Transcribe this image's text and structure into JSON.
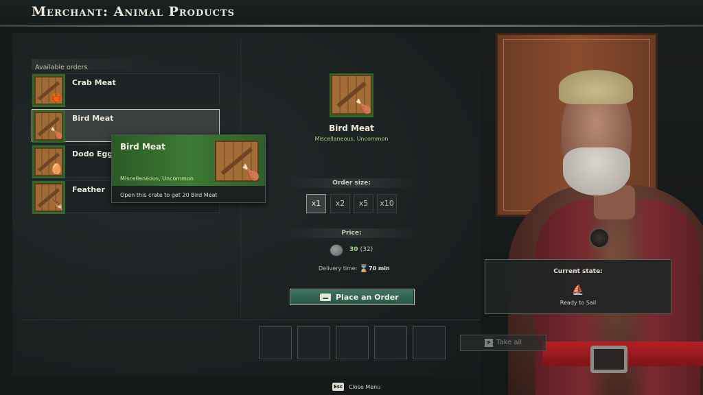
{
  "window": {
    "title": "Merchant: Animal Products"
  },
  "orders": {
    "header": "Available orders",
    "items": [
      {
        "label": "Crab Meat",
        "icon": "crab-meat-icon",
        "item_glyph": "🦀"
      },
      {
        "label": "Bird Meat",
        "icon": "bird-meat-icon",
        "item_glyph": "🍗",
        "selected": true
      },
      {
        "label": "Dodo Egg",
        "icon": "dodo-egg-icon",
        "item_glyph": "🥚"
      },
      {
        "label": "Feather",
        "icon": "feather-icon",
        "item_glyph": "🪶"
      }
    ]
  },
  "tooltip": {
    "name": "Bird Meat",
    "subtitle": "Miscellaneous, Uncommon",
    "description": "Open this crate to get 20 Bird Meat"
  },
  "detail": {
    "name": "Bird Meat",
    "subtitle": "Miscellaneous, Uncommon",
    "order_size_label": "Order size:",
    "order_sizes": [
      "x1",
      "x2",
      "x5",
      "x10"
    ],
    "selected_size": "x1",
    "price_label": "Price:",
    "price": "30",
    "price_original": "(32)",
    "delivery_label": "Delivery time:",
    "delivery_value": "70 min",
    "order_button": "Place an Order"
  },
  "delivery_slots": 5,
  "take_all": {
    "key": "F",
    "label": "Take all"
  },
  "footer": {
    "key": "Esc",
    "label": "Close Menu"
  },
  "merchant": {
    "state_title": "Current state:",
    "state_icon": "ship-icon",
    "state_value": "Ready to Sail"
  },
  "colors": {
    "accent_green": "#9fd47d",
    "button_teal": "#3e7363",
    "rarity_green": "#2d6a2a"
  }
}
